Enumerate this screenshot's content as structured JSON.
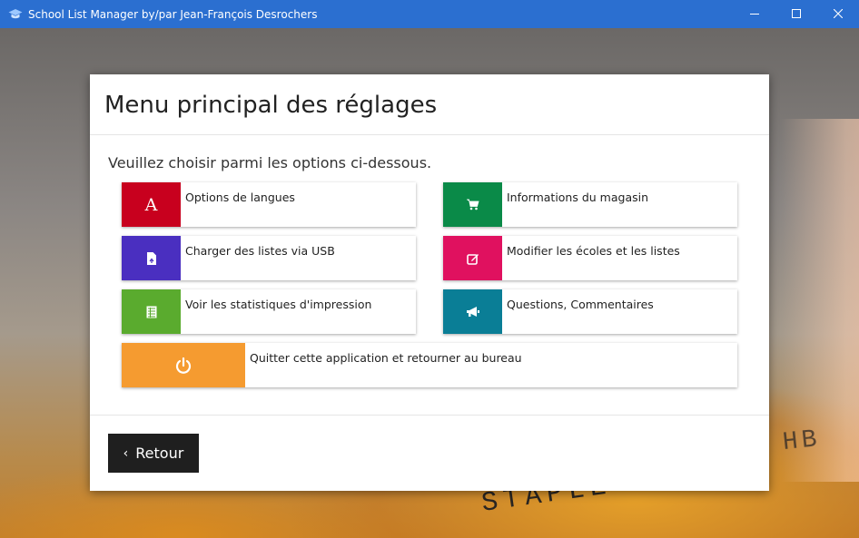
{
  "window": {
    "title": "School List Manager by/par Jean-François Desrochers",
    "icon": "graduation-cap-icon",
    "controls": {
      "minimize": "minimize-icon",
      "maximize": "maximize-icon",
      "close": "close-icon"
    }
  },
  "background": {
    "photo_text_1": "STAPLE",
    "photo_text_2": "HB"
  },
  "dialog": {
    "title": "Menu principal des réglages",
    "instructions": "Veuillez choisir parmi les options ci-dessous.",
    "tiles": [
      {
        "id": "languages",
        "label": "Options de langues",
        "icon": "letter-a-icon",
        "icon_text": "A",
        "color": "#c8001e"
      },
      {
        "id": "store",
        "label": "Informations du magasin",
        "icon": "shopping-cart-icon",
        "color": "#0a8a48"
      },
      {
        "id": "usb",
        "label": "Charger des listes via USB",
        "icon": "file-upload-icon",
        "color": "#4a2fc0"
      },
      {
        "id": "schools",
        "label": "Modifier les écoles et les listes",
        "icon": "edit-icon",
        "color": "#e0115f"
      },
      {
        "id": "stats",
        "label": "Voir les statistiques d'impression",
        "icon": "spreadsheet-icon",
        "color": "#5aab2e"
      },
      {
        "id": "feedback",
        "label": "Questions, Commentaires",
        "icon": "megaphone-icon",
        "color": "#0a7e96"
      },
      {
        "id": "quit",
        "label": "Quitter cette application et retourner au bureau",
        "icon": "power-icon",
        "color": "#f59b30"
      }
    ],
    "back_button": {
      "label": "Retour",
      "icon": "chevron-left-icon"
    }
  }
}
